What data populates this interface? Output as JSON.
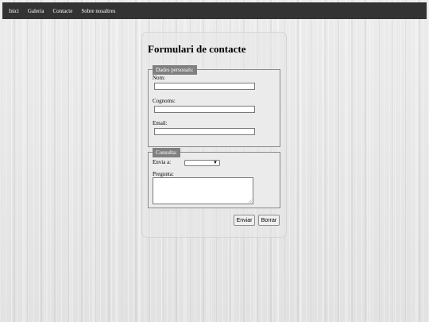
{
  "nav": {
    "items": [
      {
        "label": "Inici"
      },
      {
        "label": "Galeria"
      },
      {
        "label": "Contacte"
      },
      {
        "label": "Sobre nosaltres"
      }
    ]
  },
  "form": {
    "title": "Formulari de contacte",
    "personal": {
      "legend": "Dades personals:",
      "name_label": "Nom:",
      "name_value": "",
      "surname_label": "Cognoms:",
      "surname_value": "",
      "email_label": "Email:",
      "email_value": ""
    },
    "query": {
      "legend": "Consulta:",
      "send_to_label": "Envia a:",
      "send_to_selected": "",
      "question_label": "Pregunta:",
      "question_value": ""
    },
    "buttons": {
      "send": "Enviar",
      "clear": "Borrar"
    }
  }
}
